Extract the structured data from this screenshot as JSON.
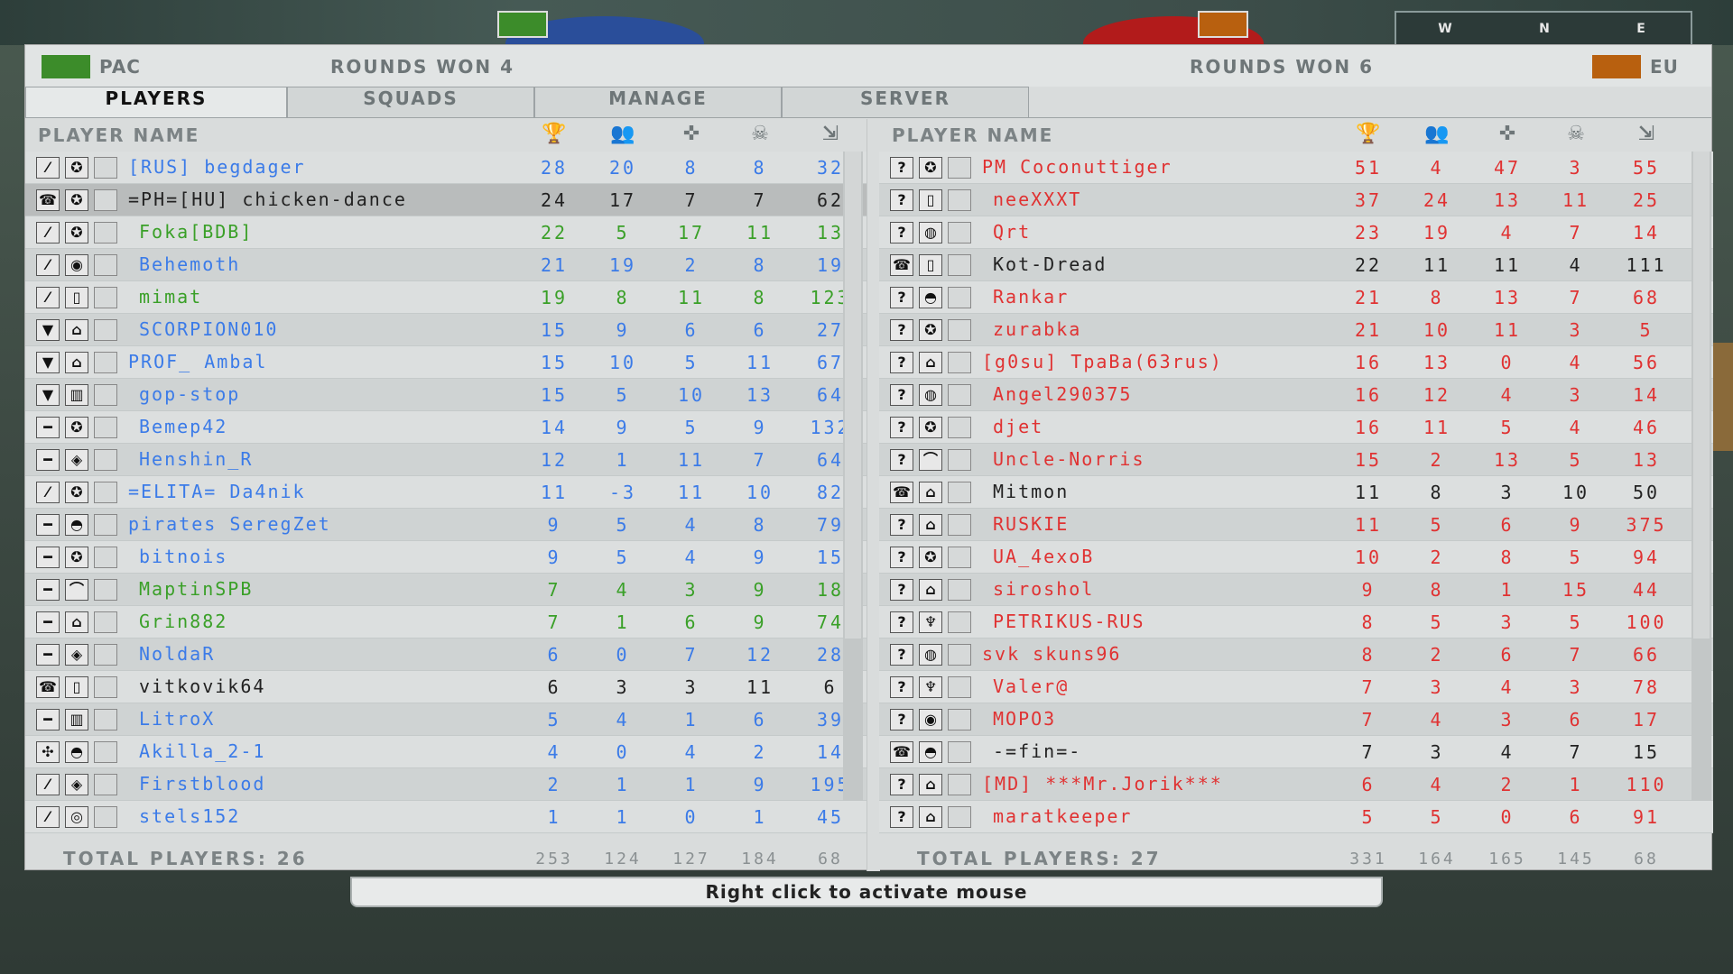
{
  "top": {
    "compass_letters": [
      "W",
      "N",
      "E"
    ]
  },
  "header": {
    "left_team": "PAC",
    "left_rounds": "ROUNDS WON 4",
    "right_team": "EU",
    "right_rounds": "ROUNDS WON 6"
  },
  "tabs": [
    {
      "label": "PLAYERS",
      "active": true
    },
    {
      "label": "SQUADS",
      "active": false
    },
    {
      "label": "MANAGE",
      "active": false
    },
    {
      "label": "SERVER",
      "active": false
    }
  ],
  "column_header": {
    "player_name": "PLAYER NAME",
    "icons": [
      "score-trophy-icon",
      "kills-soldiers-icon",
      "crosshair-icon",
      "deaths-skull-icon",
      "ping-icon"
    ]
  },
  "pac": {
    "total_label": "TOTAL PLAYERS: 26",
    "totals": [
      "253",
      "124",
      "127",
      "184",
      "68"
    ],
    "players": [
      {
        "kit": "rifle",
        "rank": "✪",
        "name": "[RUS] begdager",
        "color": "blue",
        "indent": false,
        "score": "28",
        "kills": "20",
        "teamwork": "8",
        "deaths": "8",
        "ping": "32"
      },
      {
        "kit": "commander",
        "rank": "✪",
        "name": "=PH=[HU] chicken-dance",
        "color": "black",
        "indent": false,
        "highlight": true,
        "score": "24",
        "kills": "17",
        "teamwork": "7",
        "deaths": "7",
        "ping": "62"
      },
      {
        "kit": "rifle",
        "rank": "✪",
        "name": "Foka[BDB]",
        "color": "green",
        "indent": true,
        "score": "22",
        "kills": "5",
        "teamwork": "17",
        "deaths": "11",
        "ping": "13"
      },
      {
        "kit": "rifle",
        "rank": "◉",
        "name": "Behemoth",
        "color": "blue",
        "indent": true,
        "score": "21",
        "kills": "19",
        "teamwork": "2",
        "deaths": "8",
        "ping": "19"
      },
      {
        "kit": "rifle",
        "rank": "▯",
        "name": "mimat",
        "color": "green",
        "indent": true,
        "score": "19",
        "kills": "8",
        "teamwork": "11",
        "deaths": "8",
        "ping": "123"
      },
      {
        "kit": "medic",
        "rank": "⌂",
        "name": "SCORPION010",
        "color": "blue",
        "indent": true,
        "score": "15",
        "kills": "9",
        "teamwork": "6",
        "deaths": "6",
        "ping": "27"
      },
      {
        "kit": "medic",
        "rank": "⌂",
        "name": "PROF_ Ambal",
        "color": "blue",
        "indent": false,
        "score": "15",
        "kills": "10",
        "teamwork": "5",
        "deaths": "11",
        "ping": "67"
      },
      {
        "kit": "medic",
        "rank": "▥",
        "name": "gop-stop",
        "color": "blue",
        "indent": true,
        "score": "15",
        "kills": "5",
        "teamwork": "10",
        "deaths": "13",
        "ping": "64"
      },
      {
        "kit": "gun",
        "rank": "✪",
        "name": "Bemep42",
        "color": "blue",
        "indent": true,
        "score": "14",
        "kills": "9",
        "teamwork": "5",
        "deaths": "9",
        "ping": "132"
      },
      {
        "kit": "gun",
        "rank": "◈",
        "name": "Henshin_R",
        "color": "blue",
        "indent": true,
        "score": "12",
        "kills": "1",
        "teamwork": "11",
        "deaths": "7",
        "ping": "64"
      },
      {
        "kit": "rifle",
        "rank": "✪",
        "name": "=ELITA= Da4nik",
        "color": "blue",
        "indent": false,
        "score": "11",
        "kills": "-3",
        "teamwork": "11",
        "deaths": "10",
        "ping": "82"
      },
      {
        "kit": "gun",
        "rank": "◓",
        "name": "pirates SeregZet",
        "color": "blue",
        "indent": false,
        "score": "9",
        "kills": "5",
        "teamwork": "4",
        "deaths": "8",
        "ping": "79"
      },
      {
        "kit": "gun",
        "rank": "✪",
        "name": "bitnois",
        "color": "blue",
        "indent": true,
        "score": "9",
        "kills": "5",
        "teamwork": "4",
        "deaths": "9",
        "ping": "15"
      },
      {
        "kit": "gun",
        "rank": "⌒",
        "name": "MaptinSPB",
        "color": "green",
        "indent": true,
        "score": "7",
        "kills": "4",
        "teamwork": "3",
        "deaths": "9",
        "ping": "18"
      },
      {
        "kit": "gun",
        "rank": "⌂",
        "name": "Grin882",
        "color": "green",
        "indent": true,
        "score": "7",
        "kills": "1",
        "teamwork": "6",
        "deaths": "9",
        "ping": "74"
      },
      {
        "kit": "gun",
        "rank": "◈",
        "name": "NoldaR",
        "color": "blue",
        "indent": true,
        "score": "6",
        "kills": "0",
        "teamwork": "7",
        "deaths": "12",
        "ping": "28"
      },
      {
        "kit": "commander",
        "rank": "▯",
        "name": "vitkovik64",
        "color": "black",
        "indent": true,
        "score": "6",
        "kills": "3",
        "teamwork": "3",
        "deaths": "11",
        "ping": "6"
      },
      {
        "kit": "gun",
        "rank": "▥",
        "name": "LitroX",
        "color": "blue",
        "indent": true,
        "score": "5",
        "kills": "4",
        "teamwork": "1",
        "deaths": "6",
        "ping": "39"
      },
      {
        "kit": "spec",
        "rank": "◓",
        "name": "Akilla_2-1",
        "color": "blue",
        "indent": true,
        "score": "4",
        "kills": "0",
        "teamwork": "4",
        "deaths": "2",
        "ping": "14"
      },
      {
        "kit": "rifle",
        "rank": "◈",
        "name": "Firstblood",
        "color": "blue",
        "indent": true,
        "score": "2",
        "kills": "1",
        "teamwork": "1",
        "deaths": "9",
        "ping": "195"
      },
      {
        "kit": "rifle",
        "rank": "◎",
        "name": "stels152",
        "color": "blue",
        "indent": true,
        "score": "1",
        "kills": "1",
        "teamwork": "0",
        "deaths": "1",
        "ping": "45"
      }
    ]
  },
  "eu": {
    "total_label": "TOTAL PLAYERS: 27",
    "totals": [
      "331",
      "164",
      "165",
      "145",
      "68"
    ],
    "players": [
      {
        "kit": "?",
        "rank": "✪",
        "name": "PM Coconuttiger",
        "color": "red",
        "indent": false,
        "score": "51",
        "kills": "4",
        "teamwork": "47",
        "deaths": "3",
        "ping": "55"
      },
      {
        "kit": "?",
        "rank": "▯",
        "name": "neeXXXT",
        "color": "red",
        "indent": true,
        "score": "37",
        "kills": "24",
        "teamwork": "13",
        "deaths": "11",
        "ping": "25"
      },
      {
        "kit": "?",
        "rank": "◍",
        "name": "Qrt",
        "color": "red",
        "indent": true,
        "score": "23",
        "kills": "19",
        "teamwork": "4",
        "deaths": "7",
        "ping": "14"
      },
      {
        "kit": "commander",
        "rank": "▯",
        "name": "Kot-Dread",
        "color": "black",
        "indent": true,
        "score": "22",
        "kills": "11",
        "teamwork": "11",
        "deaths": "4",
        "ping": "111"
      },
      {
        "kit": "?",
        "rank": "◓",
        "name": "Rankar",
        "color": "red",
        "indent": true,
        "score": "21",
        "kills": "8",
        "teamwork": "13",
        "deaths": "7",
        "ping": "68"
      },
      {
        "kit": "?",
        "rank": "✪",
        "name": "zurabka",
        "color": "red",
        "indent": true,
        "score": "21",
        "kills": "10",
        "teamwork": "11",
        "deaths": "3",
        "ping": "5"
      },
      {
        "kit": "?",
        "rank": "⌂",
        "name": "[g0su] TpaBa(63rus)",
        "color": "red",
        "indent": false,
        "score": "16",
        "kills": "13",
        "teamwork": "0",
        "deaths": "4",
        "ping": "56"
      },
      {
        "kit": "?",
        "rank": "◍",
        "name": "Angel290375",
        "color": "red",
        "indent": true,
        "score": "16",
        "kills": "12",
        "teamwork": "4",
        "deaths": "3",
        "ping": "14"
      },
      {
        "kit": "?",
        "rank": "✪",
        "name": "djet",
        "color": "red",
        "indent": true,
        "score": "16",
        "kills": "11",
        "teamwork": "5",
        "deaths": "4",
        "ping": "46"
      },
      {
        "kit": "?",
        "rank": "⌒",
        "name": "Uncle-Norris",
        "color": "red",
        "indent": true,
        "score": "15",
        "kills": "2",
        "teamwork": "13",
        "deaths": "5",
        "ping": "13"
      },
      {
        "kit": "commander",
        "rank": "⌂",
        "name": "Mitmon",
        "color": "black",
        "indent": true,
        "score": "11",
        "kills": "8",
        "teamwork": "3",
        "deaths": "10",
        "ping": "50"
      },
      {
        "kit": "?",
        "rank": "⌂",
        "name": "RUSKIE",
        "color": "red",
        "indent": true,
        "score": "11",
        "kills": "5",
        "teamwork": "6",
        "deaths": "9",
        "ping": "375"
      },
      {
        "kit": "?",
        "rank": "✪",
        "name": "UA_4exoB",
        "color": "red",
        "indent": true,
        "score": "10",
        "kills": "2",
        "teamwork": "8",
        "deaths": "5",
        "ping": "94"
      },
      {
        "kit": "?",
        "rank": "⌂",
        "name": "siroshol",
        "color": "red",
        "indent": true,
        "score": "9",
        "kills": "8",
        "teamwork": "1",
        "deaths": "15",
        "ping": "44"
      },
      {
        "kit": "?",
        "rank": "♆",
        "name": "PETRIKUS-RUS",
        "color": "red",
        "indent": true,
        "score": "8",
        "kills": "5",
        "teamwork": "3",
        "deaths": "5",
        "ping": "100"
      },
      {
        "kit": "?",
        "rank": "◍",
        "name": "svk skuns96",
        "color": "red",
        "indent": false,
        "score": "8",
        "kills": "2",
        "teamwork": "6",
        "deaths": "7",
        "ping": "66"
      },
      {
        "kit": "?",
        "rank": "♆",
        "name": "Valer@",
        "color": "red",
        "indent": true,
        "score": "7",
        "kills": "3",
        "teamwork": "4",
        "deaths": "3",
        "ping": "78"
      },
      {
        "kit": "?",
        "rank": "◉",
        "name": "MOPO3",
        "color": "red",
        "indent": true,
        "score": "7",
        "kills": "4",
        "teamwork": "3",
        "deaths": "6",
        "ping": "17"
      },
      {
        "kit": "commander",
        "rank": "◓",
        "name": "-=fin=-",
        "color": "black",
        "indent": true,
        "score": "7",
        "kills": "3",
        "teamwork": "4",
        "deaths": "7",
        "ping": "15"
      },
      {
        "kit": "?",
        "rank": "⌂",
        "name": "[MD] ***Mr.Jorik***",
        "color": "red",
        "indent": false,
        "score": "6",
        "kills": "4",
        "teamwork": "2",
        "deaths": "1",
        "ping": "110"
      },
      {
        "kit": "?",
        "rank": "⌂",
        "name": "maratkeeper",
        "color": "red",
        "indent": true,
        "score": "5",
        "kills": "5",
        "teamwork": "0",
        "deaths": "6",
        "ping": "91"
      }
    ]
  },
  "hint": "Right click to activate mouse",
  "colors": {
    "blue": "#3b7be8",
    "green": "#3aa028",
    "red": "#e03232",
    "pac_flag": "#3c8c2a",
    "eu_flag": "#b8600f"
  }
}
